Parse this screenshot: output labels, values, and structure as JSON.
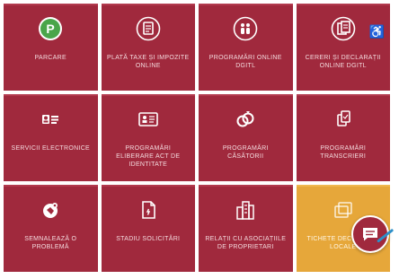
{
  "tiles": [
    {
      "label": "PARCARE",
      "icon": "parking-icon"
    },
    {
      "label": "PLATĂ TAXE ȘI IMPOZITE ONLINE",
      "icon": "payment-document-icon"
    },
    {
      "label": "PROGRAMĂRI ONLINE DGITL",
      "icon": "people-appointment-icon"
    },
    {
      "label": "CERERI ȘI DECLARAȚII ONLINE DGITL",
      "icon": "forms-document-icon"
    },
    {
      "label": "SERVICII ELECTRONICE",
      "icon": "id-card-icon"
    },
    {
      "label": "PROGRAMĂRI ELIBERARE ACT DE IDENTITATE",
      "icon": "identity-card-icon"
    },
    {
      "label": "PROGRAMĂRI CĂSĂTORII",
      "icon": "wedding-rings-icon"
    },
    {
      "label": "PROGRAMĂRI TRANSCRIERI",
      "icon": "transcription-documents-icon"
    },
    {
      "label": "SEMNALEAZĂ O PROBLEMĂ",
      "icon": "report-problem-icon"
    },
    {
      "label": "STADIU SOLICITĂRI",
      "icon": "request-status-icon"
    },
    {
      "label": "RELAȚII CU ASOCIAȚIILE DE PROPRIETARI",
      "icon": "buildings-icon"
    },
    {
      "label": "TICHETE DECONTARE LOCALE",
      "icon": "tickets-icon"
    }
  ],
  "colors": {
    "tile": "#a0293d",
    "tile_highlight": "#e6a73a",
    "text": "#f3d9dd"
  },
  "accessibility_icon": "♿",
  "chat_icon": "chat-bubble-icon"
}
